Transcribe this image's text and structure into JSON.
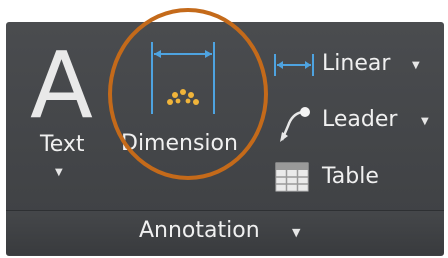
{
  "panel": {
    "title": "Annotation",
    "title_caret": "▼",
    "text_tool": {
      "glyph": "A",
      "label": "Text",
      "caret": "▼"
    },
    "dimension_tool": {
      "label": "Dimension"
    },
    "linear_tool": {
      "label": "Linear",
      "caret": "▼"
    },
    "leader_tool": {
      "label": "Leader",
      "caret": "▼"
    },
    "table_tool": {
      "label": "Table"
    }
  },
  "colors": {
    "panel_bg": "#434548",
    "text": "#f0f0f0",
    "highlight_circle": "#c46a1a",
    "dimension_line": "#4ea3e0",
    "dimension_arc": "#f0b43a"
  }
}
